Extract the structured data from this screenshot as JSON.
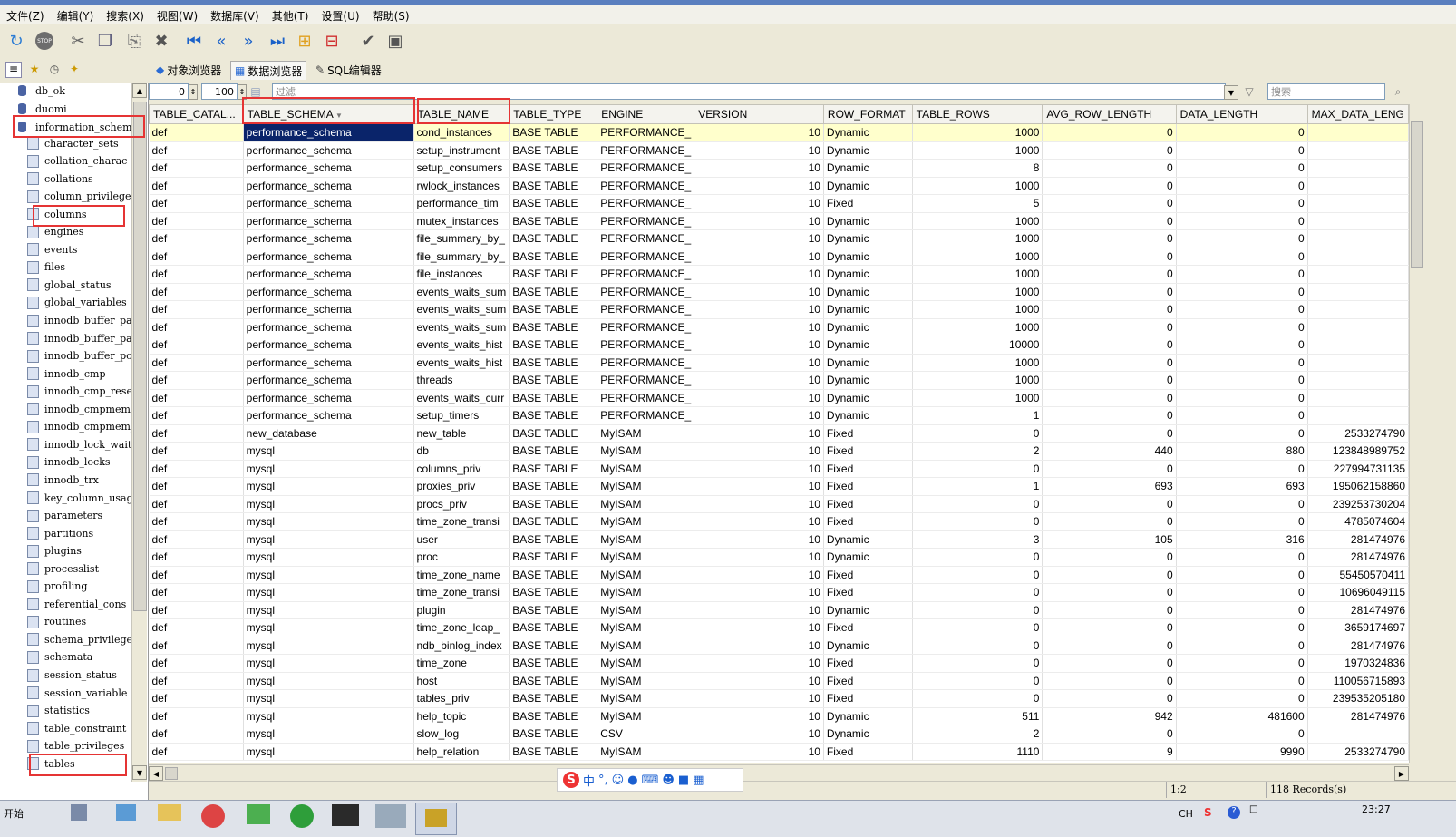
{
  "menu": [
    "文件(Z)",
    "编辑(Y)",
    "搜索(X)",
    "视图(W)",
    "数据库(V)",
    "其他(T)",
    "设置(U)",
    "帮助(S)"
  ],
  "toolbar_icons": [
    "refresh-icon",
    "stop-icon",
    "cut-icon",
    "copy-icon",
    "paste-icon",
    "delete-icon",
    "first-record-icon",
    "previous-record-icon",
    "next-record-icon",
    "last-record-icon",
    "add-row-icon",
    "remove-row-icon",
    "apply-icon",
    "cancel-icon"
  ],
  "toolbar_labels": {
    "stop": "STOP"
  },
  "tabs": [
    "对象浏览器",
    "数据浏览器",
    "SQL编辑器"
  ],
  "tree": {
    "databases": [
      "db_ok",
      "duomi",
      "information_schema"
    ],
    "tables": [
      "character_sets",
      "collation_charac",
      "collations",
      "column_privilege",
      "columns",
      "engines",
      "events",
      "files",
      "global_status",
      "global_variables",
      "innodb_buffer_pa",
      "innodb_buffer_pa",
      "innodb_buffer_po",
      "innodb_cmp",
      "innodb_cmp_reset",
      "innodb_cmpmem",
      "innodb_cmpmem_re",
      "innodb_lock_wait",
      "innodb_locks",
      "innodb_trx",
      "key_column_usage",
      "parameters",
      "partitions",
      "plugins",
      "processlist",
      "profiling",
      "referential_cons",
      "routines",
      "schema_privilege",
      "schemata",
      "session_status",
      "session_variable",
      "statistics",
      "table_constraint",
      "table_privileges",
      "tables"
    ]
  },
  "filter": {
    "offset": "0",
    "limit": "100",
    "placeholder": "过滤",
    "search_placeholder": "搜索"
  },
  "grid": {
    "columns": [
      "TABLE_CATAL...",
      "TABLE_SCHEMA",
      "TABLE_NAME",
      "TABLE_TYPE",
      "ENGINE",
      "VERSION",
      "ROW_FORMAT",
      "TABLE_ROWS",
      "AVG_ROW_LENGTH",
      "DATA_LENGTH",
      "MAX_DATA_LENG"
    ],
    "rows": [
      [
        "def",
        "performance_schema",
        "cond_instances",
        "BASE TABLE",
        "PERFORMANCE_",
        "10",
        "Dynamic",
        "1000",
        "0",
        "0",
        ""
      ],
      [
        "def",
        "performance_schema",
        "setup_instrument",
        "BASE TABLE",
        "PERFORMANCE_",
        "10",
        "Dynamic",
        "1000",
        "0",
        "0",
        ""
      ],
      [
        "def",
        "performance_schema",
        "setup_consumers",
        "BASE TABLE",
        "PERFORMANCE_",
        "10",
        "Dynamic",
        "8",
        "0",
        "0",
        ""
      ],
      [
        "def",
        "performance_schema",
        "rwlock_instances",
        "BASE TABLE",
        "PERFORMANCE_",
        "10",
        "Dynamic",
        "1000",
        "0",
        "0",
        ""
      ],
      [
        "def",
        "performance_schema",
        "performance_tim",
        "BASE TABLE",
        "PERFORMANCE_",
        "10",
        "Fixed",
        "5",
        "0",
        "0",
        ""
      ],
      [
        "def",
        "performance_schema",
        "mutex_instances",
        "BASE TABLE",
        "PERFORMANCE_",
        "10",
        "Dynamic",
        "1000",
        "0",
        "0",
        ""
      ],
      [
        "def",
        "performance_schema",
        "file_summary_by_",
        "BASE TABLE",
        "PERFORMANCE_",
        "10",
        "Dynamic",
        "1000",
        "0",
        "0",
        ""
      ],
      [
        "def",
        "performance_schema",
        "file_summary_by_",
        "BASE TABLE",
        "PERFORMANCE_",
        "10",
        "Dynamic",
        "1000",
        "0",
        "0",
        ""
      ],
      [
        "def",
        "performance_schema",
        "file_instances",
        "BASE TABLE",
        "PERFORMANCE_",
        "10",
        "Dynamic",
        "1000",
        "0",
        "0",
        ""
      ],
      [
        "def",
        "performance_schema",
        "events_waits_sum",
        "BASE TABLE",
        "PERFORMANCE_",
        "10",
        "Dynamic",
        "1000",
        "0",
        "0",
        ""
      ],
      [
        "def",
        "performance_schema",
        "events_waits_sum",
        "BASE TABLE",
        "PERFORMANCE_",
        "10",
        "Dynamic",
        "1000",
        "0",
        "0",
        ""
      ],
      [
        "def",
        "performance_schema",
        "events_waits_sum",
        "BASE TABLE",
        "PERFORMANCE_",
        "10",
        "Dynamic",
        "1000",
        "0",
        "0",
        ""
      ],
      [
        "def",
        "performance_schema",
        "events_waits_hist",
        "BASE TABLE",
        "PERFORMANCE_",
        "10",
        "Dynamic",
        "10000",
        "0",
        "0",
        ""
      ],
      [
        "def",
        "performance_schema",
        "events_waits_hist",
        "BASE TABLE",
        "PERFORMANCE_",
        "10",
        "Dynamic",
        "1000",
        "0",
        "0",
        ""
      ],
      [
        "def",
        "performance_schema",
        "threads",
        "BASE TABLE",
        "PERFORMANCE_",
        "10",
        "Dynamic",
        "1000",
        "0",
        "0",
        ""
      ],
      [
        "def",
        "performance_schema",
        "events_waits_curr",
        "BASE TABLE",
        "PERFORMANCE_",
        "10",
        "Dynamic",
        "1000",
        "0",
        "0",
        ""
      ],
      [
        "def",
        "performance_schema",
        "setup_timers",
        "BASE TABLE",
        "PERFORMANCE_",
        "10",
        "Dynamic",
        "1",
        "0",
        "0",
        ""
      ],
      [
        "def",
        "new_database",
        "new_table",
        "BASE TABLE",
        "MyISAM",
        "10",
        "Fixed",
        "0",
        "0",
        "0",
        "2533274790"
      ],
      [
        "def",
        "mysql",
        "db",
        "BASE TABLE",
        "MyISAM",
        "10",
        "Fixed",
        "2",
        "440",
        "880",
        "123848989752"
      ],
      [
        "def",
        "mysql",
        "columns_priv",
        "BASE TABLE",
        "MyISAM",
        "10",
        "Fixed",
        "0",
        "0",
        "0",
        "227994731135"
      ],
      [
        "def",
        "mysql",
        "proxies_priv",
        "BASE TABLE",
        "MyISAM",
        "10",
        "Fixed",
        "1",
        "693",
        "693",
        "195062158860"
      ],
      [
        "def",
        "mysql",
        "procs_priv",
        "BASE TABLE",
        "MyISAM",
        "10",
        "Fixed",
        "0",
        "0",
        "0",
        "239253730204"
      ],
      [
        "def",
        "mysql",
        "time_zone_transi",
        "BASE TABLE",
        "MyISAM",
        "10",
        "Fixed",
        "0",
        "0",
        "0",
        "4785074604"
      ],
      [
        "def",
        "mysql",
        "user",
        "BASE TABLE",
        "MyISAM",
        "10",
        "Dynamic",
        "3",
        "105",
        "316",
        "281474976"
      ],
      [
        "def",
        "mysql",
        "proc",
        "BASE TABLE",
        "MyISAM",
        "10",
        "Dynamic",
        "0",
        "0",
        "0",
        "281474976"
      ],
      [
        "def",
        "mysql",
        "time_zone_name",
        "BASE TABLE",
        "MyISAM",
        "10",
        "Fixed",
        "0",
        "0",
        "0",
        "55450570411"
      ],
      [
        "def",
        "mysql",
        "time_zone_transi",
        "BASE TABLE",
        "MyISAM",
        "10",
        "Fixed",
        "0",
        "0",
        "0",
        "10696049115"
      ],
      [
        "def",
        "mysql",
        "plugin",
        "BASE TABLE",
        "MyISAM",
        "10",
        "Dynamic",
        "0",
        "0",
        "0",
        "281474976"
      ],
      [
        "def",
        "mysql",
        "time_zone_leap_",
        "BASE TABLE",
        "MyISAM",
        "10",
        "Fixed",
        "0",
        "0",
        "0",
        "3659174697"
      ],
      [
        "def",
        "mysql",
        "ndb_binlog_index",
        "BASE TABLE",
        "MyISAM",
        "10",
        "Dynamic",
        "0",
        "0",
        "0",
        "281474976"
      ],
      [
        "def",
        "mysql",
        "time_zone",
        "BASE TABLE",
        "MyISAM",
        "10",
        "Fixed",
        "0",
        "0",
        "0",
        "1970324836"
      ],
      [
        "def",
        "mysql",
        "host",
        "BASE TABLE",
        "MyISAM",
        "10",
        "Fixed",
        "0",
        "0",
        "0",
        "110056715893"
      ],
      [
        "def",
        "mysql",
        "tables_priv",
        "BASE TABLE",
        "MyISAM",
        "10",
        "Fixed",
        "0",
        "0",
        "0",
        "239535205180"
      ],
      [
        "def",
        "mysql",
        "help_topic",
        "BASE TABLE",
        "MyISAM",
        "10",
        "Dynamic",
        "511",
        "942",
        "481600",
        "281474976"
      ],
      [
        "def",
        "mysql",
        "slow_log",
        "BASE TABLE",
        "CSV",
        "10",
        "Dynamic",
        "2",
        "0",
        "0",
        ""
      ],
      [
        "def",
        "mysql",
        "help_relation",
        "BASE TABLE",
        "MyISAM",
        "10",
        "Fixed",
        "1110",
        "9",
        "9990",
        "2533274790"
      ]
    ]
  },
  "status": {
    "position": "1:2",
    "records": "118 Records(s)"
  },
  "taskbar": {
    "start": "开始",
    "time": "23:27",
    "lang": "CH"
  },
  "ime": {
    "label": "中"
  }
}
